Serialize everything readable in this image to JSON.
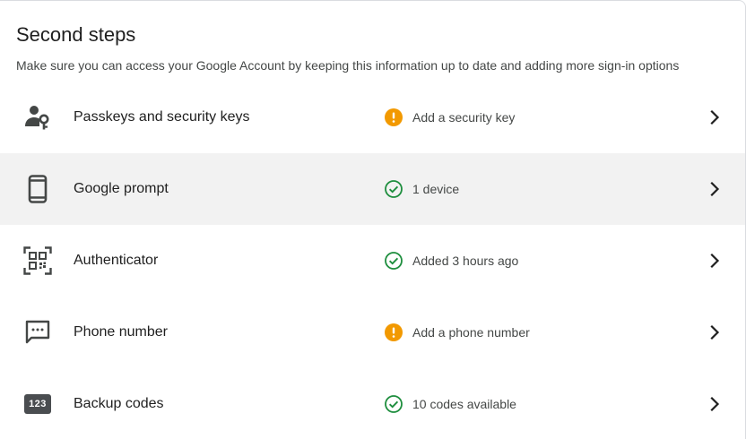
{
  "section": {
    "title": "Second steps",
    "subtitle": "Make sure you can access your Google Account by keeping this information up to date and adding more sign-in options"
  },
  "items": [
    {
      "label": "Passkeys and security keys",
      "status": "Add a security key",
      "status_type": "warning",
      "icon": "passkey-icon"
    },
    {
      "label": "Google prompt",
      "status": "1 device",
      "status_type": "ok",
      "icon": "phone-device-icon"
    },
    {
      "label": "Authenticator",
      "status": "Added 3 hours ago",
      "status_type": "ok",
      "icon": "qr-code-icon"
    },
    {
      "label": "Phone number",
      "status": "Add a phone number",
      "status_type": "warning",
      "icon": "sms-message-icon"
    },
    {
      "label": "Backup codes",
      "status": "10 codes available",
      "status_type": "ok",
      "icon": "backup-codes-icon",
      "icon_text": "123"
    }
  ],
  "colors": {
    "warning": "#f29900",
    "ok": "#1e8e3e",
    "icon_gray": "#444746",
    "hover_bg": "#f2f2f2"
  }
}
